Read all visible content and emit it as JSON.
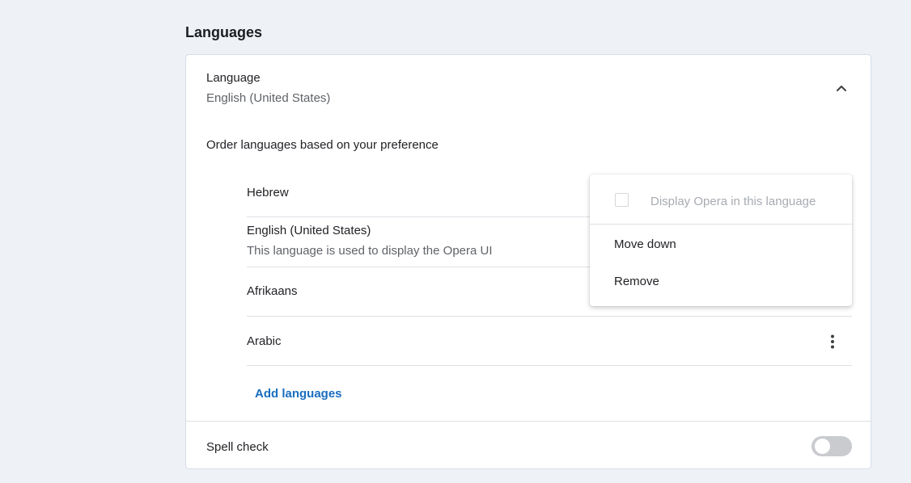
{
  "section": {
    "title": "Languages"
  },
  "language_setting": {
    "title": "Language",
    "current_value": "English (United States)",
    "collapse_icon": "chevron-up-icon"
  },
  "order": {
    "label": "Order languages based on your preference",
    "items": [
      {
        "name": "Hebrew",
        "sub": ""
      },
      {
        "name": "English (United States)",
        "sub": "This language is used to display the Opera UI"
      },
      {
        "name": "Afrikaans",
        "sub": ""
      },
      {
        "name": "Arabic",
        "sub": ""
      }
    ],
    "more_icon": "more-vertical-icon",
    "add_label": "Add languages"
  },
  "context_menu": {
    "display_label": "Display Opera in this language",
    "display_checked": false,
    "move_down_label": "Move down",
    "remove_label": "Remove"
  },
  "spell_check": {
    "label": "Spell check",
    "enabled": false
  },
  "colors": {
    "page_background": "#eef2f7",
    "link": "#1a6dbf",
    "toggle_off": "#c9cbcf"
  }
}
